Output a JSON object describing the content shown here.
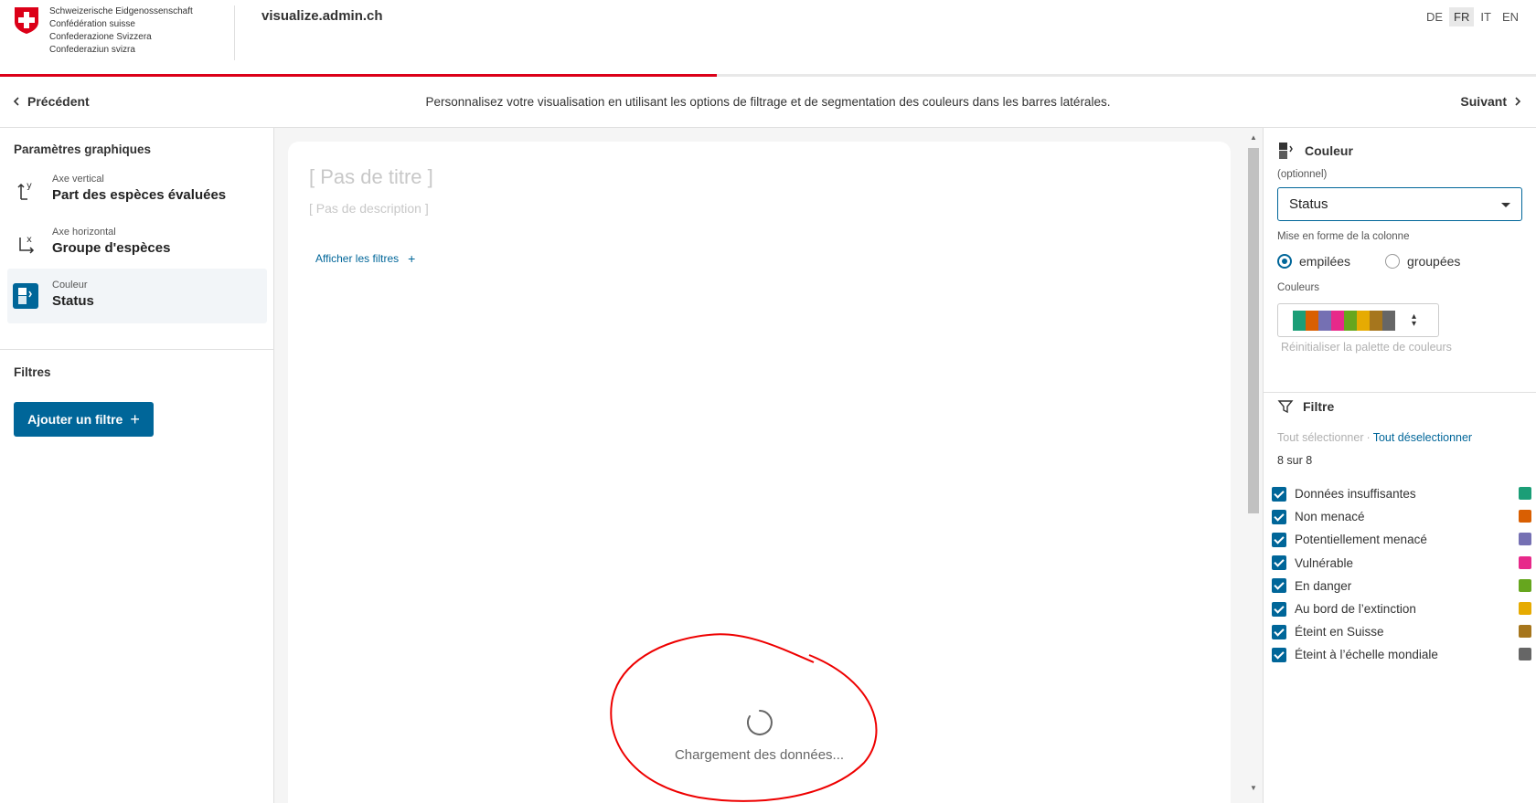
{
  "header": {
    "logo_lines": [
      "Schweizerische Eidgenossenschaft",
      "Confédération suisse",
      "Confederazione Svizzera",
      "Confederaziun svizra"
    ],
    "site_name": "visualize.admin.ch",
    "languages": [
      "DE",
      "FR",
      "IT",
      "EN"
    ],
    "active_language": "FR",
    "progress_percent": 50,
    "progress_color": "#dc0018"
  },
  "stepbar": {
    "prev_label": "Précédent",
    "next_label": "Suivant",
    "hint": "Personnalisez votre visualisation en utilisant les options de filtrage et de segmentation des couleurs dans les barres latérales."
  },
  "left_panel": {
    "title": "Paramètres graphiques",
    "params": [
      {
        "sub": "Axe vertical",
        "main": "Part des espèces évaluées",
        "icon": "y-axis-icon"
      },
      {
        "sub": "Axe horizontal",
        "main": "Groupe d'espèces",
        "icon": "x-axis-icon"
      },
      {
        "sub": "Couleur",
        "main": "Status",
        "icon": "color-segment-icon",
        "active": true
      }
    ],
    "filters_title": "Filtres",
    "add_filter_label": "Ajouter un filtre",
    "accent": "#006699"
  },
  "chart": {
    "title_placeholder": "[ Pas de titre ]",
    "description_placeholder": "[ Pas de description ]",
    "show_filters_label": "Afficher les filtres",
    "loading_text": "Chargement des données..."
  },
  "right_panel": {
    "color_title": "Couleur",
    "optional_label": "(optionnel)",
    "color_select_value": "Status",
    "column_format_label": "Mise en forme de la colonne",
    "radio_options": [
      {
        "label": "empilées",
        "selected": true
      },
      {
        "label": "groupées",
        "selected": false
      }
    ],
    "colors_label": "Couleurs",
    "palette": [
      "#1b9e77",
      "#d95f02",
      "#7570b3",
      "#e7298a",
      "#66a61e",
      "#e6ab02",
      "#a6761d",
      "#666666"
    ],
    "reset_palette_label": "Réinitialiser la palette de couleurs",
    "filter_title": "Filtre",
    "select_all_label": "Tout sélectionner",
    "deselect_all_label": "Tout déselectionner",
    "count_label": "8 sur 8",
    "filter_items": [
      {
        "label": "Données insuffisantes",
        "color": "#1b9e77"
      },
      {
        "label": "Non menacé",
        "color": "#d95f02"
      },
      {
        "label": "Potentiellement menacé",
        "color": "#7570b3"
      },
      {
        "label": "Vulnérable",
        "color": "#e7298a"
      },
      {
        "label": "En danger",
        "color": "#66a61e"
      },
      {
        "label": "Au bord de l’extinction",
        "color": "#e6ab02"
      },
      {
        "label": "Éteint en Suisse",
        "color": "#a6761d"
      },
      {
        "label": "Éteint à l’échelle mondiale",
        "color": "#666666"
      }
    ]
  }
}
